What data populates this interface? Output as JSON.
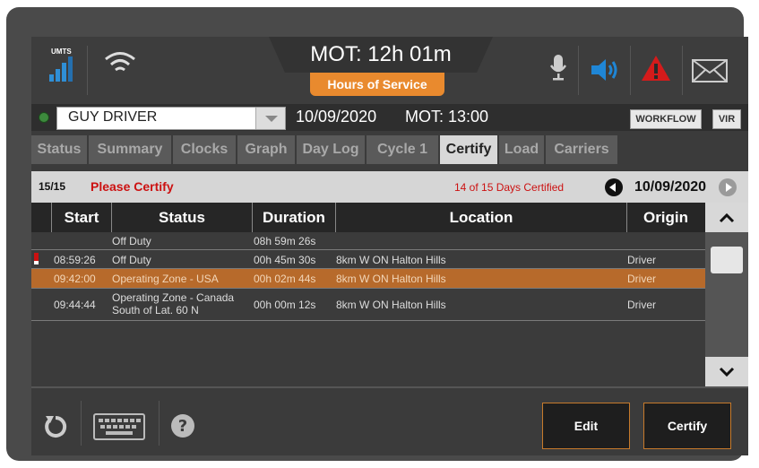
{
  "status": {
    "network": "UMTS",
    "mot_title": "MOT: 12h 01m",
    "hos_label": "Hours of Service"
  },
  "driver": {
    "name": "GUY DRIVER",
    "date": "10/09/2020",
    "mot": "MOT: 13:00",
    "workflow_label": "WORKFLOW",
    "vir_label": "VIR"
  },
  "tabs": [
    {
      "label": "Status",
      "active": false
    },
    {
      "label": "Summary",
      "active": false
    },
    {
      "label": "Clocks",
      "active": false
    },
    {
      "label": "Graph",
      "active": false
    },
    {
      "label": "Day Log",
      "active": false
    },
    {
      "label": "Cycle 1",
      "active": false
    },
    {
      "label": "Certify",
      "active": true
    },
    {
      "label": "Load",
      "active": false
    },
    {
      "label": "Carriers",
      "active": false
    }
  ],
  "certify": {
    "count": "15/15",
    "prompt": "Please Certify",
    "certified_summary": "14 of 15 Days Certified",
    "current_date": "10/09/2020"
  },
  "table": {
    "columns": [
      "Start",
      "Status",
      "Duration",
      "Location",
      "Origin"
    ],
    "rows": [
      {
        "start": "",
        "status": "Off Duty",
        "duration": "08h 59m 26s",
        "location": "",
        "origin": "",
        "flag": false,
        "selected": false
      },
      {
        "start": "08:59:26",
        "status": "Off Duty",
        "duration": "00h 45m 30s",
        "location": "8km W ON Halton Hills",
        "origin": "Driver",
        "flag": true,
        "selected": false
      },
      {
        "start": "09:42:00",
        "status": "Operating Zone - USA",
        "duration": "00h 02m 44s",
        "location": "8km W ON Halton Hills",
        "origin": "Driver",
        "flag": false,
        "selected": true
      },
      {
        "start": "09:44:44",
        "status": "Operating Zone - Canada",
        "status_line2": "South of Lat. 60 N",
        "duration": "00h 00m 12s",
        "location": "8km W ON Halton Hills",
        "origin": "Driver",
        "flag": false,
        "selected": false
      }
    ]
  },
  "actions": {
    "edit_label": "Edit",
    "certify_label": "Certify"
  },
  "colors": {
    "accent": "#e98a2e",
    "selected_row": "#b76a2b",
    "alert_red": "#cc1111",
    "signal_blue": "#2f8fd6"
  }
}
